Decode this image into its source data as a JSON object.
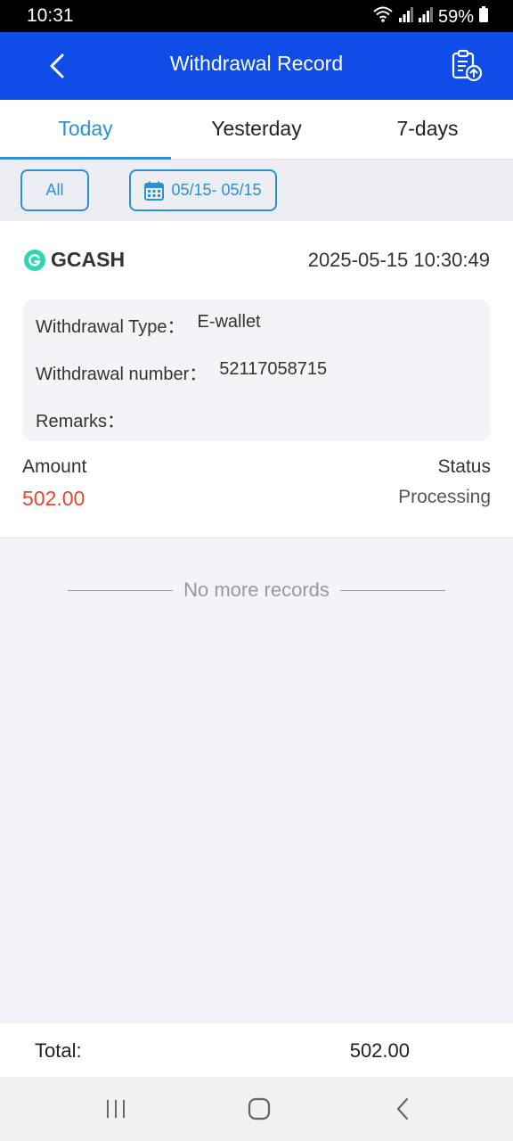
{
  "status_bar": {
    "time": "10:31",
    "battery": "59%"
  },
  "header": {
    "title": "Withdrawal Record"
  },
  "tabs": [
    {
      "label": "Today",
      "active": true
    },
    {
      "label": "Yesterday",
      "active": false
    },
    {
      "label": "7-days",
      "active": false
    }
  ],
  "filter": {
    "type_label": "All",
    "date_range": "05/15- 05/15"
  },
  "record": {
    "provider": "GCASH",
    "datetime": "2025-05-15 10:30:49",
    "type_label": "Withdrawal Type：",
    "type_value": "E-wallet",
    "number_label": "Withdrawal number：",
    "number_value": "52117058715",
    "remarks_label": "Remarks：",
    "remarks_value": "",
    "amount_label": "Amount",
    "amount_value": "502.00",
    "status_label": "Status",
    "status_value": "Processing"
  },
  "list_end": {
    "text": "No more records"
  },
  "total": {
    "label": "Total:",
    "value": "502.00"
  },
  "colors": {
    "header_bg": "#0f4ce8",
    "accent": "#2d8fd8",
    "amount": "#e04a2f",
    "gcash": "#2fd6b2"
  }
}
